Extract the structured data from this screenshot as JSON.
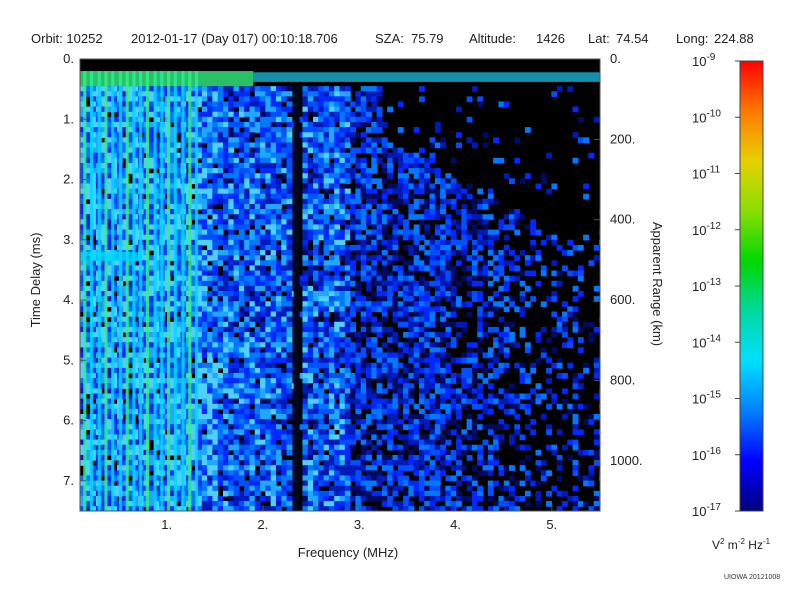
{
  "header": {
    "orbit": "Orbit: 10252",
    "datetime": "2012-01-17 (Day 017) 00:10:18.706",
    "sza_label": "SZA:",
    "sza_value": "75.79",
    "altitude_label": "Altitude:",
    "altitude_value": "1426",
    "lat_label": "Lat:",
    "lat_value": "74.54",
    "long_label": "Long:",
    "long_value": "224.88"
  },
  "colorbar": {
    "units_parts": [
      "V",
      "2",
      " m",
      "-2",
      " Hz",
      "-1"
    ],
    "tick_base": "10",
    "tick_exponents": [
      "-9",
      "-10",
      "-11",
      "-12",
      "-13",
      "-14",
      "-15",
      "-16",
      "-17"
    ],
    "stops": [
      "#ff0000",
      "#ff7a00",
      "#e8d000",
      "#88e000",
      "#00d800",
      "#00d8a0",
      "#00e0ff",
      "#0080ff",
      "#0000ff",
      "#000080"
    ]
  },
  "credit": "UIOWA 20121008",
  "colors": {
    "background": "#000000",
    "trace_bright": "#35f080",
    "trace_cyan": "#00d8ff",
    "noise_blue": "#0028ff"
  },
  "chart_data": {
    "type": "heatmap",
    "title": "",
    "xlabel": "Frequency (MHz)",
    "ylabel": "Time Delay (ms)",
    "y2label": "Apparent Range (km)",
    "xlim": [
      0.1,
      5.5
    ],
    "ylim": [
      0.0,
      7.5
    ],
    "y_inverted": true,
    "x_ticks": [
      1,
      2,
      3,
      4,
      5
    ],
    "x_tick_labels": [
      "1.",
      "2.",
      "3.",
      "4.",
      "5."
    ],
    "y_ticks": [
      0,
      1,
      2,
      3,
      4,
      5,
      6,
      7
    ],
    "y_tick_labels": [
      "0.",
      "1.",
      "2.",
      "3.",
      "4.",
      "5.",
      "6.",
      "7."
    ],
    "y2_ticks_km": [
      0,
      200,
      400,
      600,
      800,
      1000
    ],
    "y2_tick_labels": [
      "0.",
      "200.",
      "400.",
      "600.",
      "800.",
      "1000."
    ],
    "colorscale": {
      "min": 1e-17,
      "max": 1e-09,
      "log": true
    },
    "features": {
      "surface_echo_delay_ms": 0.3,
      "vertical_lines_mhz": [
        0.15,
        0.22,
        0.3,
        0.37,
        0.44,
        0.52,
        0.59,
        0.66,
        0.73,
        0.8,
        0.88,
        0.95,
        1.02,
        1.09,
        1.17,
        1.24,
        1.31
      ],
      "dark_gap_mhz": 2.35,
      "noise_extent_mhz": 5.5
    }
  }
}
